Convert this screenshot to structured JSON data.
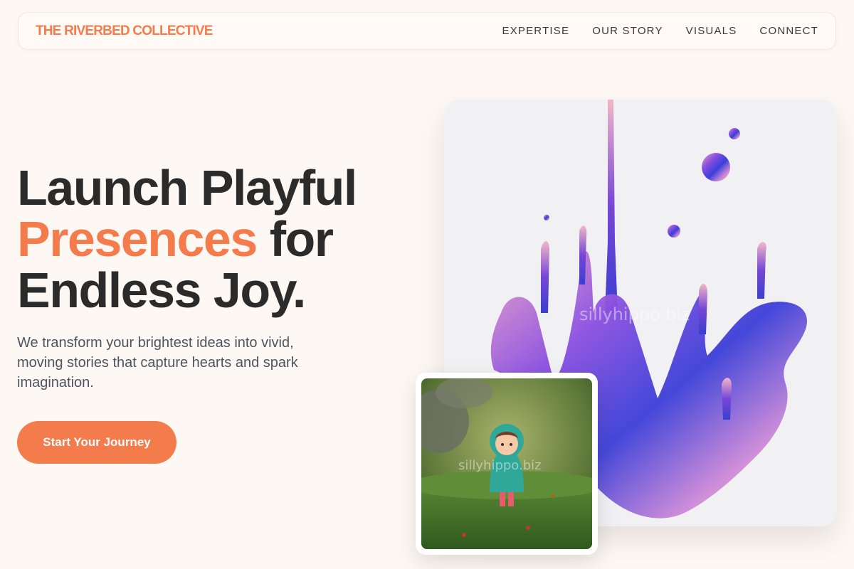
{
  "brand": "THE RIVERBED COLLECTIVE",
  "nav": [
    "EXPERTISE",
    "OUR STORY",
    "VISUALS",
    "CONNECT"
  ],
  "hero": {
    "line1": "Launch Playful",
    "accent": "Presences",
    "line2_rest": " for",
    "line3": "Endless Joy.",
    "subtitle": "We transform your brightest ideas into vivid, moving stories that capture hearts and spark imagination.",
    "cta": "Start Your Journey"
  },
  "images": {
    "main_watermark": "sillyhippo.biz",
    "small_watermark": "sillyhippo.biz"
  },
  "colors": {
    "accent": "#f47c4c",
    "background": "#fdf8f3",
    "text": "#2b2b2b"
  }
}
